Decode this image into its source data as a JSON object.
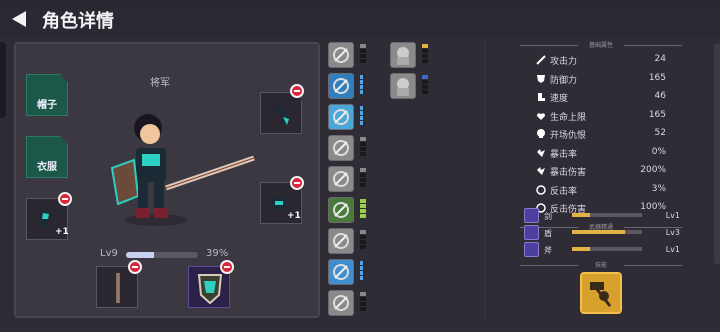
{
  "header": {
    "title": "角色详情",
    "back_icon": "back-arrow-icon"
  },
  "character": {
    "rank": "将军",
    "level_label": "Lv9",
    "level_progress_label": "39%",
    "level_progress": 0.39
  },
  "equipment": {
    "slots": [
      {
        "id": "hat",
        "label": "帽子"
      },
      {
        "id": "clothes",
        "label": "衣服"
      }
    ],
    "plus_left": "+1",
    "plus_right": "+1"
  },
  "skills_column": {
    "icons": [
      {
        "name": "sword-skill-icon",
        "color": "#8a8a8a"
      },
      {
        "name": "warrior-skill-icon",
        "color": "#2f7fbf"
      },
      {
        "name": "frost-skill-icon",
        "color": "#4aa8d8"
      },
      {
        "name": "rune-skill-icon",
        "color": "#8a8a8a"
      },
      {
        "name": "staff-skill-icon",
        "color": "#8a8a8a"
      },
      {
        "name": "nature-skill-icon",
        "color": "#4a7a3a"
      },
      {
        "name": "beast-skill-icon",
        "color": "#8a8a8a"
      },
      {
        "name": "wing-skill-icon",
        "color": "#3f8fd0"
      },
      {
        "name": "compass-skill-icon",
        "color": "#8a8a8a"
      }
    ],
    "icons_col2": [
      {
        "name": "shadow-skill-icon",
        "color": "#8a8a8a"
      },
      {
        "name": "spirit-skill-icon",
        "color": "#8a8a8a"
      }
    ]
  },
  "stats": {
    "section_title": "基础属性",
    "rows": [
      {
        "name": "攻击力",
        "value": "24",
        "icon": "sword-icon"
      },
      {
        "name": "防御力",
        "value": "165",
        "icon": "shield-icon"
      },
      {
        "name": "速度",
        "value": "46",
        "icon": "boot-icon"
      },
      {
        "name": "生命上限",
        "value": "165",
        "icon": "heart-icon"
      },
      {
        "name": "开场仇恨",
        "value": "52",
        "icon": "skull-icon"
      },
      {
        "name": "暴击率",
        "value": "0%",
        "icon": "crit-icon"
      },
      {
        "name": "暴击伤害",
        "value": "200%",
        "icon": "crit-damage-icon"
      },
      {
        "name": "反击率",
        "value": "3%",
        "icon": "counter-icon"
      },
      {
        "name": "反击伤害",
        "value": "100%",
        "icon": "counter-damage-icon"
      }
    ]
  },
  "weapon_mastery": {
    "section_title": "武器精通",
    "rows": [
      {
        "name": "剑",
        "level": "Lv1",
        "progress": 0.25
      },
      {
        "name": "盾",
        "level": "Lv3",
        "progress": 0.75
      },
      {
        "name": "斧",
        "level": "Lv1",
        "progress": 0.25
      }
    ]
  },
  "skill": {
    "section_title": "技能"
  },
  "colors": {
    "accent_green": "#1c5848",
    "minus_red": "#d9263a",
    "gold": "#e2b341"
  }
}
